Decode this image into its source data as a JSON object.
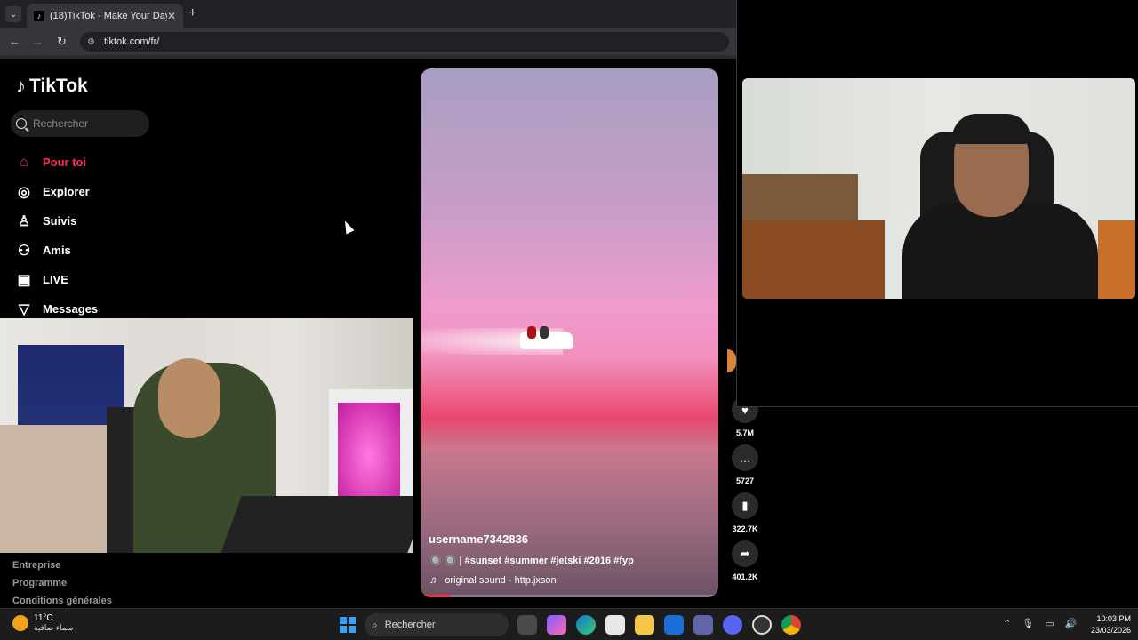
{
  "browser": {
    "tab_title": "(18)TikTok - Make Your Day",
    "tab_close": "✕",
    "new_tab": "+",
    "url": "tiktok.com/fr/"
  },
  "tiktok": {
    "logo": "TikTok",
    "search_placeholder": "Rechercher",
    "nav": [
      {
        "label": "Pour toi",
        "icon": "home-icon"
      },
      {
        "label": "Explorer",
        "icon": "compass-icon"
      },
      {
        "label": "Suivis",
        "icon": "following-icon"
      },
      {
        "label": "Amis",
        "icon": "friends-icon"
      },
      {
        "label": "LIVE",
        "icon": "live-icon"
      },
      {
        "label": "Messages",
        "icon": "messages-icon"
      }
    ],
    "footer": [
      "Entreprise",
      "Programme",
      "Conditions générales"
    ],
    "video": {
      "author": "username7342836",
      "caption": "🔘 🔘 | #sunset #summer #jetski #2016 #fyp",
      "sound": "original sound - http.jxson",
      "progress": 0.1
    },
    "actions": [
      {
        "icon": "heart-icon",
        "count": "5.7M"
      },
      {
        "icon": "comment-icon",
        "count": "5727"
      },
      {
        "icon": "bookmark-icon",
        "count": "322.7K"
      },
      {
        "icon": "share-icon",
        "count": "401.2K"
      }
    ],
    "accent": "#fe2c55"
  },
  "taskbar": {
    "temp": "11°C",
    "weather": "سماء صافية",
    "search_label": "Rechercher",
    "time": "10:03 PM",
    "date": "23/03/2026"
  }
}
